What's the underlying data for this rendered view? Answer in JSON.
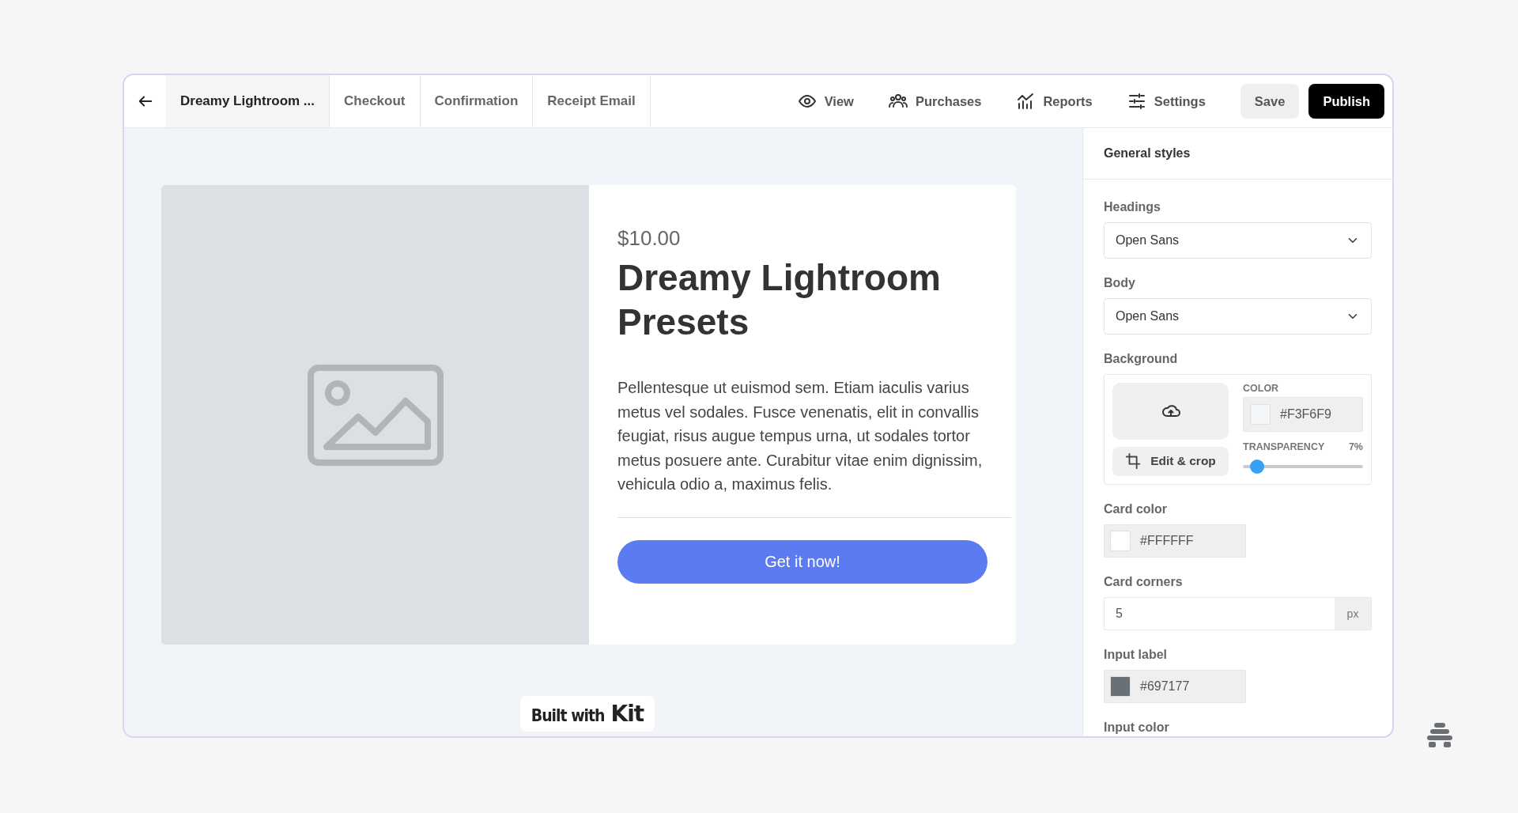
{
  "tabs": [
    {
      "label": "Dreamy Lightroom ...",
      "selected": true
    },
    {
      "label": "Checkout",
      "selected": false
    },
    {
      "label": "Confirmation",
      "selected": false
    },
    {
      "label": "Receipt Email",
      "selected": false
    }
  ],
  "actions": [
    {
      "label": "View"
    },
    {
      "label": "Purchases"
    },
    {
      "label": "Reports"
    },
    {
      "label": "Settings"
    }
  ],
  "buttons": [
    {
      "label": "Save",
      "kind": "secondary"
    },
    {
      "label": "Publish",
      "kind": "primary"
    }
  ],
  "product": {
    "price": "$10.00",
    "title": "Dreamy Lightroom Presets",
    "description": "Pellentesque ut euismod sem. Etiam iaculis varius metus vel sodales. Fusce venenatis, elit in convallis feugiat, risus augue tempus urna, ut sodales tortor metus posuere ante. Curabitur vitae enim dignissim, vehicula odio a, maximus felis.",
    "button": "Get it now!"
  },
  "badge": {
    "text": "Built with",
    "brand": "Kit"
  },
  "sidebar": {
    "title": "General styles",
    "fields": [
      {
        "kind": "select",
        "label": "Headings",
        "value": "Open Sans"
      },
      {
        "kind": "select",
        "label": "Body",
        "value": "Open Sans"
      },
      {
        "kind": "background",
        "label": "Background",
        "button": "Edit & crop",
        "color_label": "COLOR",
        "value": "#F3F6F9",
        "color": "#f3f6f9",
        "transparency_label": "TRANSPARENCY",
        "reading": "7%",
        "level": 0.07
      },
      {
        "kind": "color",
        "label": "Card color",
        "value": "#FFFFFF",
        "color": "#ffffff"
      },
      {
        "kind": "unit",
        "label": "Card corners",
        "value": "5",
        "unit": "px"
      },
      {
        "kind": "color",
        "label": "Input label",
        "value": "#697177",
        "color": "#697177"
      },
      {
        "kind": "label",
        "label": "Input color"
      }
    ]
  }
}
